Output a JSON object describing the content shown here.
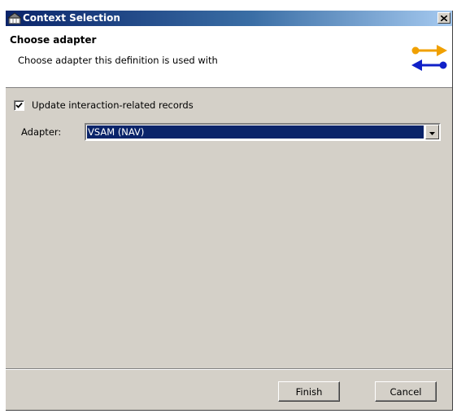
{
  "window": {
    "title": "Context Selection",
    "close_icon": "close-icon"
  },
  "header": {
    "title": "Choose adapter",
    "description": "Choose adapter this definition is used with",
    "icon": "exchange-arrows-icon"
  },
  "form": {
    "update_checkbox": {
      "label": "Update interaction-related records",
      "checked": true
    },
    "adapter": {
      "label": "Adapter:",
      "value": "VSAM (NAV)"
    }
  },
  "buttons": {
    "finish": "Finish",
    "cancel": "Cancel"
  },
  "colors": {
    "titlebar_start": "#0a246a",
    "titlebar_end": "#a6caf0",
    "selection": "#0a246a",
    "arrow_orange": "#f0a000",
    "arrow_blue": "#1020c8",
    "dialog_bg": "#d4d0c8"
  }
}
